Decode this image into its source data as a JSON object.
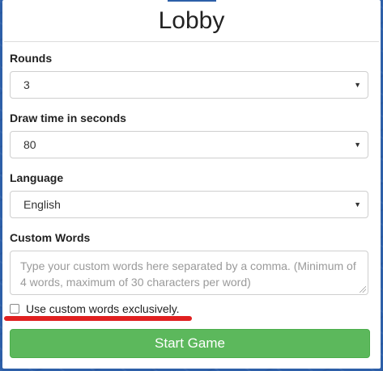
{
  "lobby": {
    "title": "Lobby"
  },
  "settings": {
    "rounds": {
      "label": "Rounds",
      "value": "3"
    },
    "draw_time": {
      "label": "Draw time in seconds",
      "value": "80"
    },
    "language": {
      "label": "Language",
      "value": "English"
    },
    "custom_words": {
      "label": "Custom Words",
      "placeholder": "Type your custom words here separated by a comma. (Minimum of 4 words, maximum of 30 characters per word)"
    },
    "exclusive": {
      "label": "Use custom words exclusively.",
      "checked": false
    }
  },
  "actions": {
    "start_label": "Start Game"
  },
  "colors": {
    "background": "#2d5fa8",
    "start_button": "#5cb85c",
    "annotation_underline": "#e02020"
  },
  "icons": {
    "select_caret": "caret-down-icon"
  }
}
